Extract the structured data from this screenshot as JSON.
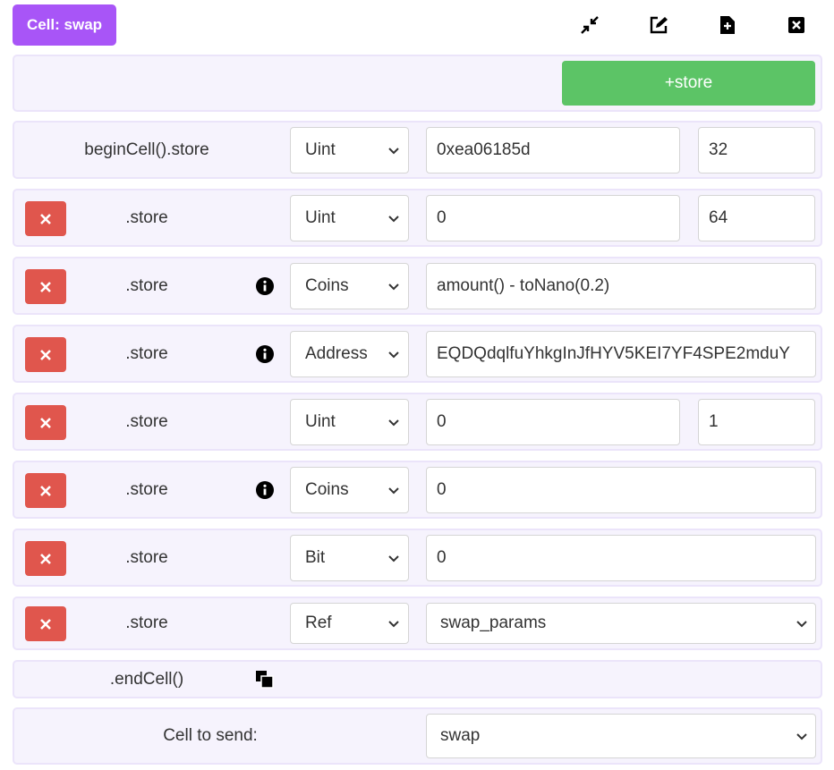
{
  "header": {
    "cell_title": "Cell: swap",
    "icons": [
      "compress-icon",
      "edit-icon",
      "new-file-icon",
      "close-icon"
    ]
  },
  "add_store_label": "+store",
  "begin": {
    "label": "beginCell().store",
    "type": "Uint",
    "value": "0xea06185d",
    "bits": "32"
  },
  "rows": [
    {
      "label": ".store",
      "type": "Uint",
      "value": "0",
      "bits": "64",
      "info": false
    },
    {
      "label": ".store",
      "type": "Coins",
      "value": "amount() - toNano(0.2)",
      "info": true
    },
    {
      "label": ".store",
      "type": "Address",
      "value": "EQDQdqlfuYhkgInJfHYV5KEI7YF4SPE2mduY",
      "info": true
    },
    {
      "label": ".store",
      "type": "Uint",
      "value": "0",
      "bits": "1",
      "info": false
    },
    {
      "label": ".store",
      "type": "Coins",
      "value": "0",
      "info": true
    },
    {
      "label": ".store",
      "type": "Bit",
      "value": "0",
      "info": false
    },
    {
      "label": ".store",
      "type": "Ref",
      "value": "swap_params",
      "info": false
    }
  ],
  "end_label": ".endCell()",
  "send": {
    "label": "Cell to send:",
    "value": "swap"
  },
  "colors": {
    "accent_purple": "#a855f7",
    "add_green": "#5cc466",
    "delete_red": "#e0564d",
    "row_bg": "#f6f3fd"
  }
}
